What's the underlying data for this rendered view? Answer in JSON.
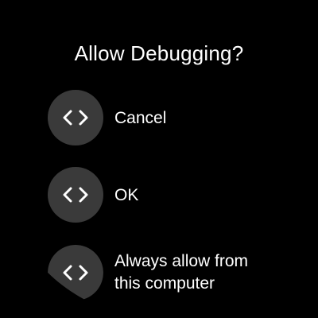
{
  "dialog": {
    "title": "Allow Debugging?"
  },
  "options": [
    {
      "label": "Cancel",
      "icon": "code-brackets-icon"
    },
    {
      "label": "OK",
      "icon": "code-brackets-icon"
    },
    {
      "label_line1": "Always allow from",
      "label_line2": "this computer",
      "icon": "code-brackets-icon"
    }
  ],
  "colors": {
    "background": "#000000",
    "icon_circle": "#3a3a3a",
    "text": "#ffffff"
  }
}
